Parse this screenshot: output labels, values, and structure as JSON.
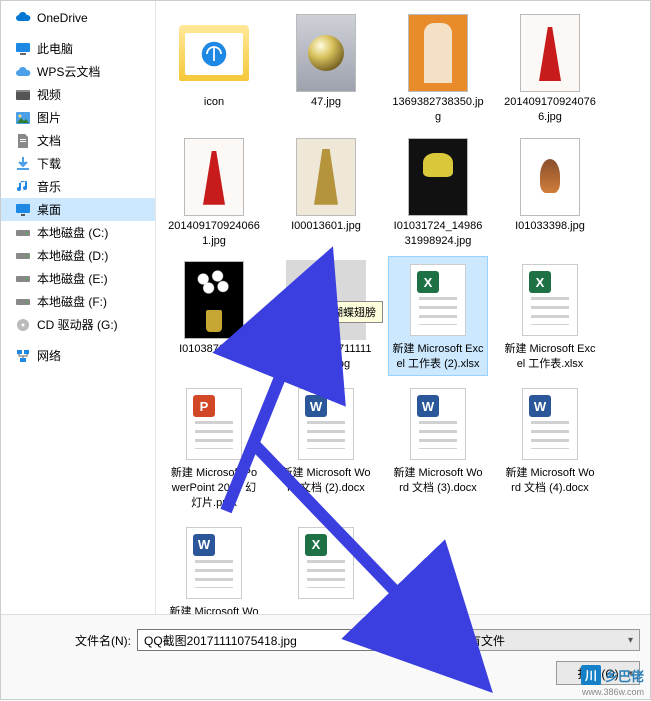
{
  "sidebar": {
    "items": [
      {
        "label": "OneDrive",
        "icon": "onedrive"
      },
      {
        "label": "此电脑",
        "icon": "this-pc"
      },
      {
        "label": "WPS云文档",
        "icon": "cloud"
      },
      {
        "label": "视频",
        "icon": "video"
      },
      {
        "label": "图片",
        "icon": "pictures"
      },
      {
        "label": "文档",
        "icon": "documents"
      },
      {
        "label": "下载",
        "icon": "downloads"
      },
      {
        "label": "音乐",
        "icon": "music"
      },
      {
        "label": "桌面",
        "icon": "desktop",
        "selected": true
      },
      {
        "label": "本地磁盘 (C:)",
        "icon": "disk"
      },
      {
        "label": "本地磁盘 (D:)",
        "icon": "disk"
      },
      {
        "label": "本地磁盘 (E:)",
        "icon": "disk"
      },
      {
        "label": "本地磁盘 (F:)",
        "icon": "disk"
      },
      {
        "label": "CD 驱动器 (G:)",
        "icon": "cd"
      },
      {
        "label": "网络",
        "icon": "network"
      }
    ]
  },
  "files": [
    {
      "name": "icon",
      "kind": "folder"
    },
    {
      "name": "47.jpg",
      "kind": "image",
      "visual": "sphere"
    },
    {
      "name": "1369382738350.jpg",
      "kind": "image",
      "visual": "girl-orange"
    },
    {
      "name": "2014091709240766.jpg",
      "kind": "image",
      "visual": "dress-red"
    },
    {
      "name": "2014091709240661.jpg",
      "kind": "image",
      "visual": "dress-red"
    },
    {
      "name": "I00013601.jpg",
      "kind": "image",
      "visual": "dress-yellow"
    },
    {
      "name": "I01031724_1498631998924.jpg",
      "kind": "image",
      "visual": "tulips"
    },
    {
      "name": "I01033398.jpg",
      "kind": "image",
      "visual": "bird"
    },
    {
      "name": "I01038706.jpg",
      "kind": "image",
      "visual": "lilies"
    },
    {
      "name": "QQ截图20171111107541.jpg",
      "kind": "image",
      "visual": "graytile",
      "tooltip": "黑色水晶蝴蝶翅膀"
    },
    {
      "name": "新建 Microsoft Excel 工作表 (2).xlsx",
      "kind": "xlsx",
      "selected": true
    },
    {
      "name": "新建 Microsoft Excel 工作表.xlsx",
      "kind": "xlsx"
    },
    {
      "name": "新建 Microsoft PowerPoint 2007 幻灯片.pptx",
      "kind": "pptx"
    },
    {
      "name": "新建 Microsoft Word 文档 (2).docx",
      "kind": "docx"
    },
    {
      "name": "新建 Microsoft Word 文档 (3).docx",
      "kind": "docx"
    },
    {
      "name": "新建 Microsoft Word 文档 (4).docx",
      "kind": "docx"
    },
    {
      "name": "新建 Microsoft Word 文档",
      "kind": "docx"
    },
    {
      "name": "",
      "kind": "xlsx"
    }
  ],
  "footer": {
    "filename_label": "文件名(N):",
    "filename_value": "QQ截图20171111075418.jpg",
    "filter_label": "所有文件",
    "open_label": "打开(O)"
  },
  "watermark": {
    "brand": "乡巴佬",
    "url": "www.386w.com"
  }
}
